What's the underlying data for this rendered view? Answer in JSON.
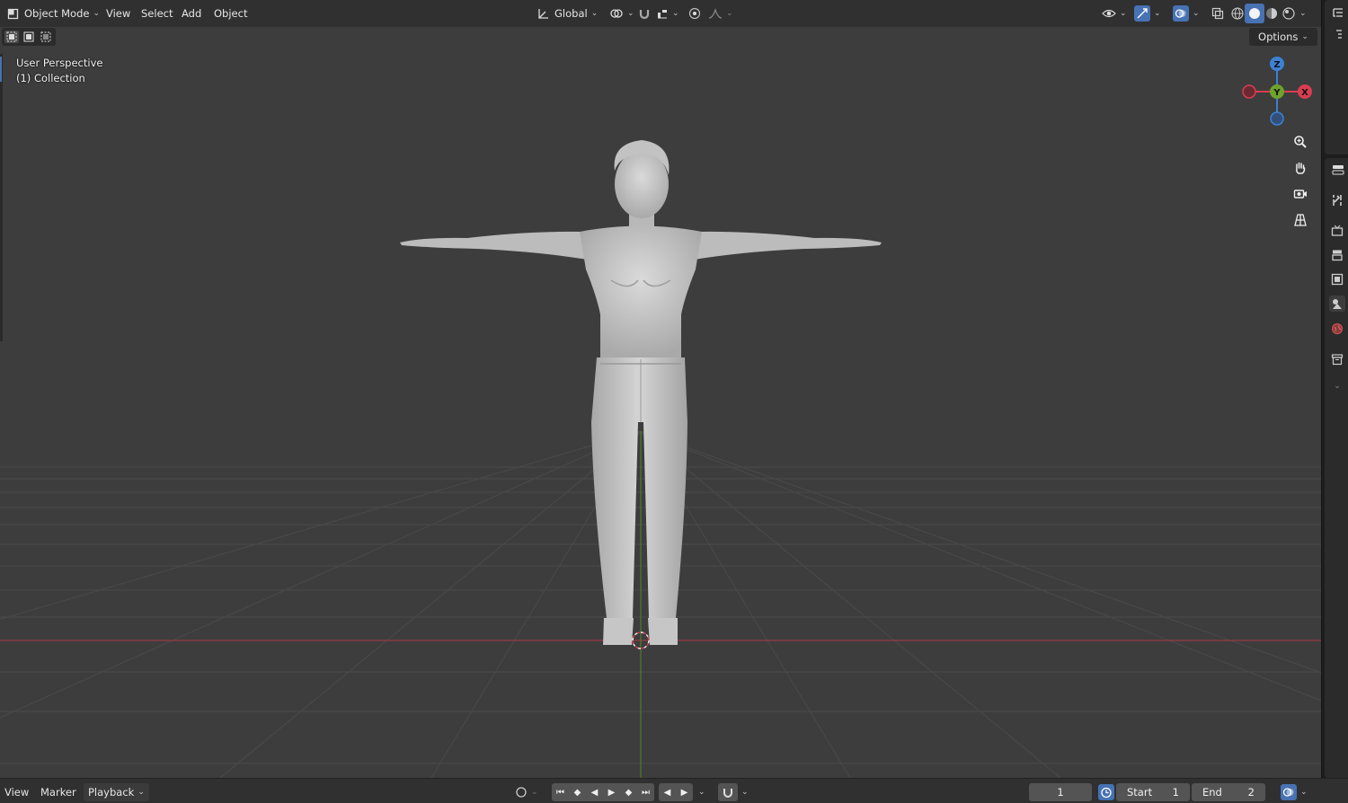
{
  "header": {
    "mode_label": "Object Mode",
    "menus": [
      "View",
      "Select",
      "Add",
      "Object"
    ],
    "transform_orientation": "Global",
    "options_label": "Options"
  },
  "viewport": {
    "view_name": "User Perspective",
    "collection": "(1) Collection",
    "gizmo": {
      "z": "Z",
      "y": "Y",
      "x": "X"
    }
  },
  "footer": {
    "menus": [
      "View",
      "Marker"
    ],
    "playback_label": "Playback",
    "current_frame": "1",
    "start_label": "Start",
    "start_value": "1",
    "end_label": "End",
    "end_value": "2"
  },
  "colors": {
    "x_axis": "#d93d50",
    "y_axis": "#6fa32b",
    "z_axis": "#3b82d6",
    "accent": "#4772b3",
    "grid": "#4d4d4d",
    "figure": "#cfcfcf"
  },
  "icons": {
    "editor_type": "cube-icon",
    "nav": [
      "zoom-icon",
      "hand-icon",
      "camera-icon",
      "grid-icon"
    ],
    "property_tabs": [
      "tool-icon",
      "render-icon",
      "output-icon",
      "view-layer-icon",
      "scene-icon",
      "world-icon",
      "collection-icon"
    ]
  }
}
